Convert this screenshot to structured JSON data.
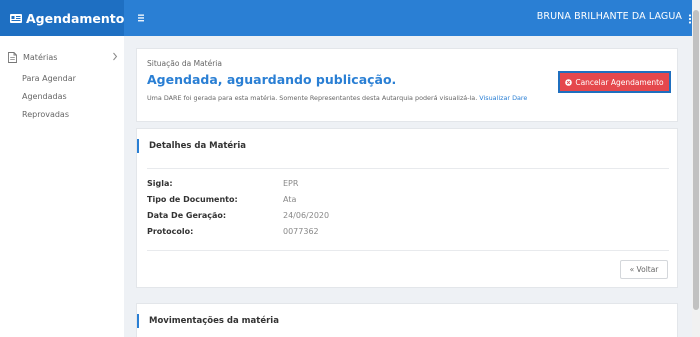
{
  "header": {
    "brand": "Agendamento",
    "brand_icon": "id-card-icon",
    "menu_icon": "hamburger-icon",
    "user_name": "BRUNA BRILHANTE DA LAGUA",
    "user_menu_icon": "vertical-dots-icon",
    "brand_color": "#1e6fc2",
    "bar_color": "#2a7fd4"
  },
  "sidebar": {
    "section_label": "Matérias",
    "section_icon": "document-icon",
    "items": [
      {
        "label": "Para Agendar"
      },
      {
        "label": "Agendadas"
      },
      {
        "label": "Reprovadas"
      }
    ]
  },
  "status": {
    "label": "Situação da Matéria",
    "title": "Agendada, aguardando publicação.",
    "note": "Uma DARE foi gerada para esta matéria. Somente Representantes desta Autarquia poderá visualizá-la.",
    "note_link": "Visualizar Dare",
    "cancel_button": "Cancelar Agendamento",
    "cancel_color": "#e5484d"
  },
  "details": {
    "title": "Detalhes da Matéria",
    "fields": [
      {
        "key": "Sigla:",
        "value": "EPR"
      },
      {
        "key": "Tipo de Documento:",
        "value": "Ata"
      },
      {
        "key": "Data De Geração:",
        "value": "24/06/2020"
      },
      {
        "key": "Protocolo:",
        "value": "0077362"
      }
    ],
    "back_button": "« Voltar"
  },
  "movements": {
    "title": "Movimentações da matéria"
  }
}
